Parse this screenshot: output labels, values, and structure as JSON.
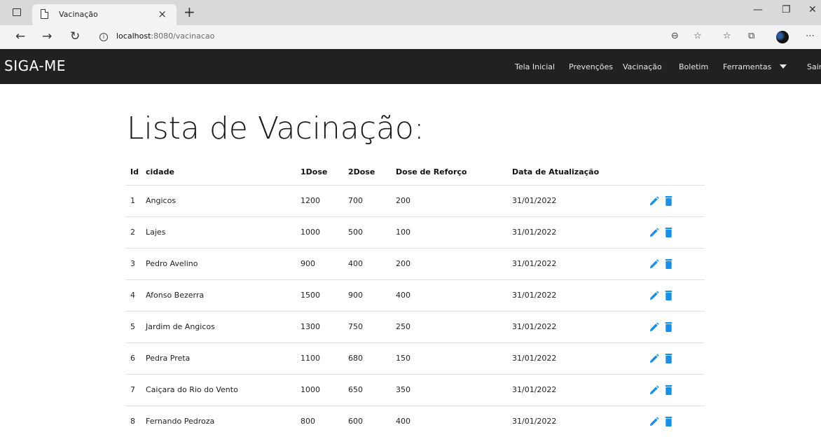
{
  "browser": {
    "tab_title": "Vacinação",
    "url_host": "localhost",
    "url_rest": ":8080/vacinacao"
  },
  "navbar": {
    "brand": "SIGA-ME",
    "links": [
      "Tela Inicial",
      "Prevenções",
      "Vacinação",
      "Boletim",
      "Ferramentas",
      "Sair"
    ]
  },
  "page": {
    "title": "Lista de Vacinação:"
  },
  "table": {
    "headers": [
      "Id",
      "cidade",
      "1Dose",
      "2Dose",
      "Dose de Reforço",
      "Data de Atualização"
    ],
    "rows": [
      [
        "1",
        "Angicos",
        "1200",
        "700",
        "200",
        "31/01/2022"
      ],
      [
        "2",
        "Lajes",
        "1000",
        "500",
        "100",
        "31/01/2022"
      ],
      [
        "3",
        "Pedro Avelino",
        "900",
        "400",
        "200",
        "31/01/2022"
      ],
      [
        "4",
        "Afonso Bezerra",
        "1500",
        "900",
        "400",
        "31/01/2022"
      ],
      [
        "5",
        "Jardim de Angicos",
        "1300",
        "750",
        "250",
        "31/01/2022"
      ],
      [
        "6",
        "Pedra Preta",
        "1100",
        "680",
        "150",
        "31/01/2022"
      ],
      [
        "7",
        "Caiçara do Rio do Vento",
        "1000",
        "650",
        "350",
        "31/01/2022"
      ],
      [
        "8",
        "Fernando Pedroza",
        "800",
        "600",
        "400",
        "31/01/2022"
      ]
    ]
  },
  "icons": {
    "edit": "pencil-icon",
    "delete": "trash-icon"
  },
  "colors": {
    "navbar_bg": "#212121",
    "action_blue": "#1a8fe3"
  }
}
